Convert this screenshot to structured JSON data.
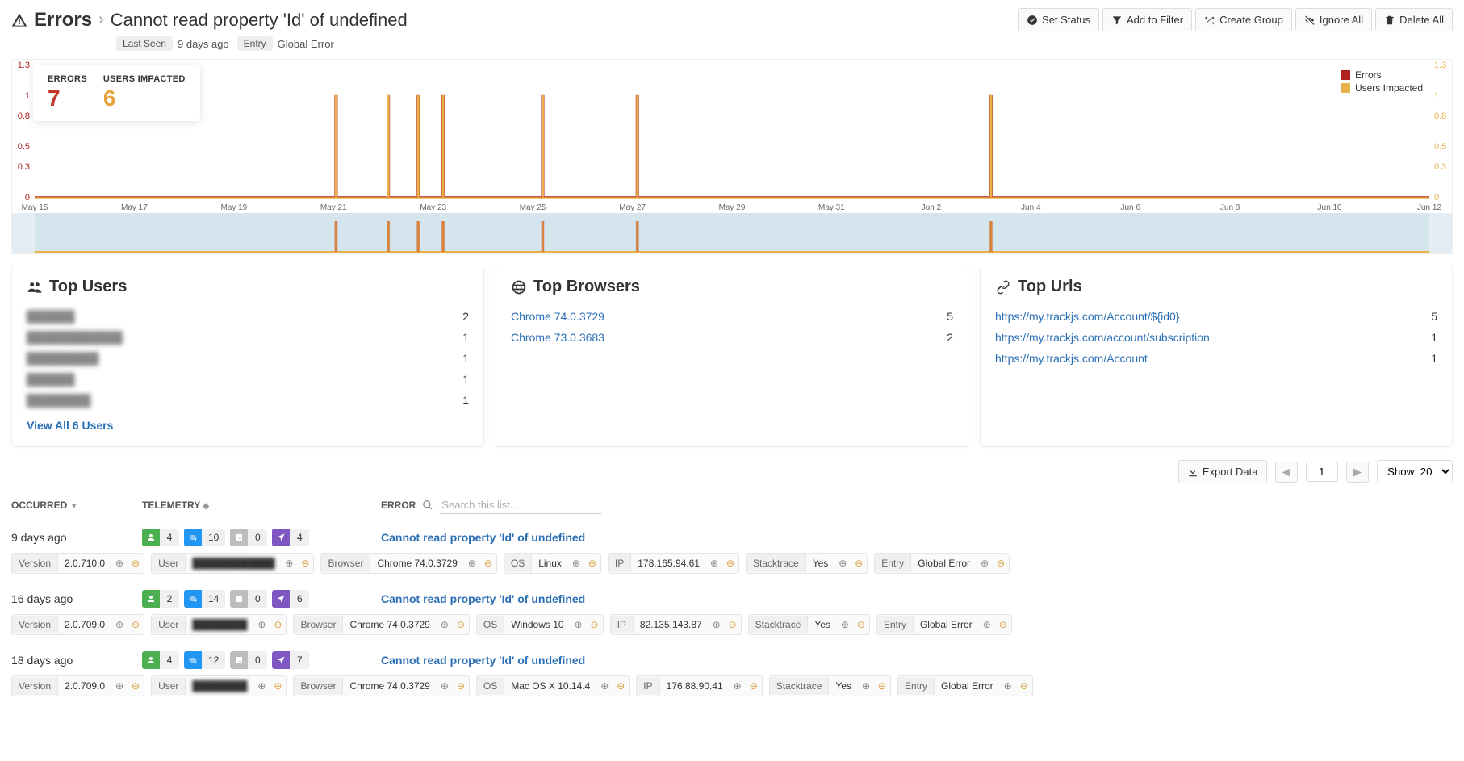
{
  "header": {
    "title": "Errors",
    "subtitle": "Cannot read property 'Id' of undefined",
    "actions": {
      "set_status": "Set Status",
      "add_filter": "Add to Filter",
      "create_group": "Create Group",
      "ignore_all": "Ignore All",
      "delete_all": "Delete All"
    },
    "meta": {
      "last_seen_label": "Last Seen",
      "last_seen_value": "9 days ago",
      "entry_label": "Entry",
      "entry_value": "Global Error"
    }
  },
  "summary": {
    "errors_label": "ERRORS",
    "errors_value": "7",
    "users_label": "USERS IMPACTED",
    "users_value": "6"
  },
  "legend": {
    "errors": "Errors",
    "users": "Users Impacted"
  },
  "colors": {
    "errors": "#b21f1f",
    "users": "#e8b14a"
  },
  "chart_data": {
    "type": "bar",
    "xlabel": "",
    "ylabel_left": "",
    "ylabel_right": "",
    "ylim": [
      0,
      1.3
    ],
    "left_ticks": [
      0,
      0.3,
      0.5,
      0.8,
      1,
      1.3
    ],
    "right_ticks": [
      0,
      0.3,
      0.5,
      0.8,
      1,
      1.3
    ],
    "categories": [
      "May 15",
      "May 17",
      "May 19",
      "May 21",
      "May 23",
      "May 25",
      "May 27",
      "May 29",
      "May 31",
      "Jun 2",
      "Jun 4",
      "Jun 6",
      "Jun 8",
      "Jun 10",
      "Jun 12"
    ],
    "series": [
      {
        "name": "Errors",
        "color": "#b21f1f",
        "events": [
          {
            "x": "May 21",
            "offset": 0.05,
            "value": 1
          },
          {
            "x": "May 22",
            "offset": 0.1,
            "value": 1
          },
          {
            "x": "May 22",
            "offset": 0.7,
            "value": 1
          },
          {
            "x": "May 23",
            "offset": 0.2,
            "value": 1
          },
          {
            "x": "May 25",
            "offset": 0.2,
            "value": 1
          },
          {
            "x": "May 27",
            "offset": 0.1,
            "value": 1
          },
          {
            "x": "Jun 3",
            "offset": 0.2,
            "value": 1
          }
        ]
      },
      {
        "name": "Users Impacted",
        "color": "#e8b14a",
        "events": [
          {
            "x": "May 21",
            "offset": 0.05,
            "value": 1
          },
          {
            "x": "May 22",
            "offset": 0.1,
            "value": 1
          },
          {
            "x": "May 22",
            "offset": 0.7,
            "value": 1
          },
          {
            "x": "May 23",
            "offset": 0.2,
            "value": 1
          },
          {
            "x": "May 25",
            "offset": 0.2,
            "value": 1
          },
          {
            "x": "May 27",
            "offset": 0.1,
            "value": 1
          },
          {
            "x": "Jun 3",
            "offset": 0.2,
            "value": 1
          }
        ]
      }
    ]
  },
  "top_users": {
    "title": "Top Users",
    "rows": [
      {
        "label": "██████",
        "count": 2
      },
      {
        "label": "████████████",
        "count": 1
      },
      {
        "label": "█████████",
        "count": 1
      },
      {
        "label": "██████",
        "count": 1
      },
      {
        "label": "████████",
        "count": 1
      }
    ],
    "view_all": "View All 6 Users"
  },
  "top_browsers": {
    "title": "Top Browsers",
    "rows": [
      {
        "label": "Chrome 74.0.3729",
        "count": 5
      },
      {
        "label": "Chrome 73.0.3683",
        "count": 2
      }
    ]
  },
  "top_urls": {
    "title": "Top Urls",
    "rows": [
      {
        "label": "https://my.trackjs.com/Account/${id0}",
        "count": 5
      },
      {
        "label": "https://my.trackjs.com/account/subscription",
        "count": 1
      },
      {
        "label": "https://my.trackjs.com/Account",
        "count": 1
      }
    ]
  },
  "list": {
    "export": "Export Data",
    "page": "1",
    "show_label": "Show: 20",
    "headers": {
      "occurred": "OCCURRED",
      "telemetry": "TELEMETRY",
      "error": "ERROR",
      "search_placeholder": "Search this list..."
    },
    "chip_labels": {
      "version": "Version",
      "user": "User",
      "browser": "Browser",
      "os": "OS",
      "ip": "IP",
      "stacktrace": "Stacktrace",
      "entry": "Entry"
    },
    "rows": [
      {
        "occurred": "9 days ago",
        "telemetry": {
          "user": 4,
          "net": 10,
          "console": 0,
          "nav": 4
        },
        "message": "Cannot read property 'Id' of undefined",
        "chips": {
          "version": "2.0.710.0",
          "user": "████████████",
          "browser": "Chrome 74.0.3729",
          "os": "Linux",
          "ip": "178.165.94.61",
          "stacktrace": "Yes",
          "entry": "Global Error"
        }
      },
      {
        "occurred": "16 days ago",
        "telemetry": {
          "user": 2,
          "net": 14,
          "console": 0,
          "nav": 6
        },
        "message": "Cannot read property 'Id' of undefined",
        "chips": {
          "version": "2.0.709.0",
          "user": "████████",
          "browser": "Chrome 74.0.3729",
          "os": "Windows 10",
          "ip": "82.135.143.87",
          "stacktrace": "Yes",
          "entry": "Global Error"
        }
      },
      {
        "occurred": "18 days ago",
        "telemetry": {
          "user": 4,
          "net": 12,
          "console": 0,
          "nav": 7
        },
        "message": "Cannot read property 'Id' of undefined",
        "chips": {
          "version": "2.0.709.0",
          "user": "████████",
          "browser": "Chrome 74.0.3729",
          "os": "Mac OS X 10.14.4",
          "ip": "176.88.90.41",
          "stacktrace": "Yes",
          "entry": "Global Error"
        }
      }
    ]
  }
}
